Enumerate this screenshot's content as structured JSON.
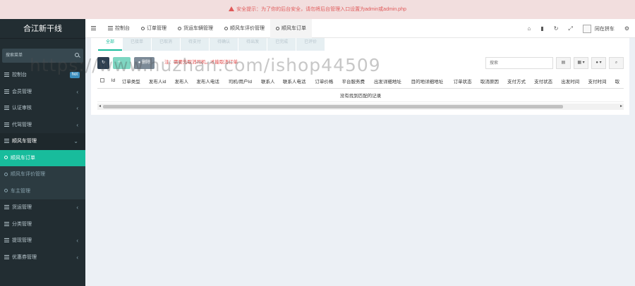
{
  "alert": {
    "text": "安全提示：为了你的后台安全，请勿将后台管理入口设置为admin或admin.php"
  },
  "sidebar": {
    "logo": "合江新干线",
    "search_placeholder": "搜索菜单",
    "items": [
      {
        "label": "控制台",
        "badge": "hot"
      },
      {
        "label": "会员管理",
        "chevron": "‹"
      },
      {
        "label": "认证审核",
        "chevron": "‹"
      },
      {
        "label": "代驾管理",
        "chevron": "‹"
      },
      {
        "label": "顺风车管理",
        "chevron": "⌄"
      },
      {
        "label": "顺风车订单"
      },
      {
        "label": "顺风车评价管理"
      },
      {
        "label": "车主管理"
      },
      {
        "label": "货运管理",
        "chevron": "‹"
      },
      {
        "label": "分类管理"
      },
      {
        "label": "提现管理",
        "chevron": "‹"
      },
      {
        "label": "优惠券管理",
        "chevron": "‹"
      }
    ]
  },
  "topnav": {
    "tabs": [
      {
        "label": "控制台"
      },
      {
        "label": "订单管理"
      },
      {
        "label": "货运车辆管理"
      },
      {
        "label": "顺风车评价管理"
      },
      {
        "label": "顺风车订单"
      }
    ],
    "user_name": "同在拼车"
  },
  "panel": {
    "subtabs": [
      "全部",
      "已接单",
      "已取消",
      "待支付",
      "待确认",
      "待出发",
      "已完成",
      "已评价"
    ],
    "notice": "注：需要先取消司机，才能取消订单",
    "delete_label": "删除",
    "search_placeholder": "搜索",
    "columns": [
      "Id",
      "订单类型",
      "发布人id",
      "发布人",
      "发布人电话",
      "司机/用户Id",
      "联系人",
      "联系人电话",
      "订单价格",
      "平台服务费",
      "出发详细地址",
      "目的地详细地址",
      "订单状态",
      "取消原因",
      "支付方式",
      "支付状态",
      "出发时间",
      "支付时间",
      "取"
    ],
    "empty_text": "没有找到匹配的记录"
  },
  "watermark": "https://www.huzhan.com/ishop44509"
}
